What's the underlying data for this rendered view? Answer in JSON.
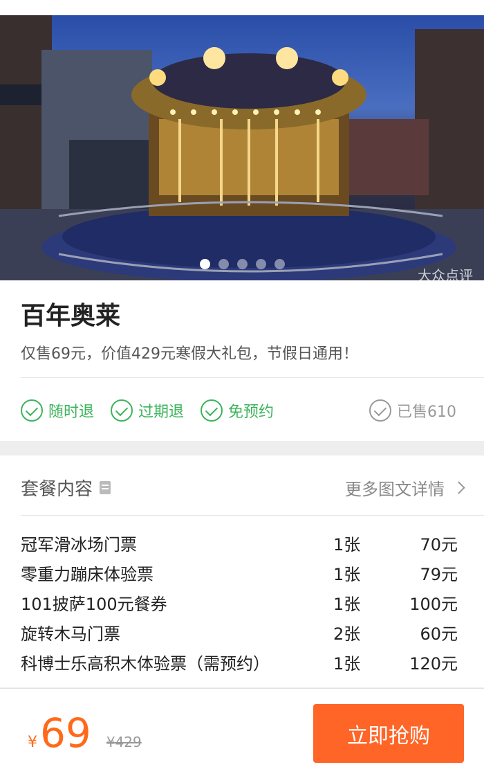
{
  "hero": {
    "image_desc": "carousel",
    "watermark": "大众点评",
    "carousel_dots": 5,
    "active_dot": 1
  },
  "deal": {
    "title": "百年奥莱",
    "subtitle": "仅售69元，价值429元寒假大礼包，节假日通用！",
    "badges": [
      "随时退",
      "过期退",
      "免预约"
    ],
    "sold": "已售610"
  },
  "package": {
    "title": "套餐内容",
    "more_link": "更多图文详情",
    "items": [
      {
        "name": "冠军滑冰场门票",
        "qty": "1张",
        "price": "70元"
      },
      {
        "name": "零重力蹦床体验票",
        "qty": "1张",
        "price": "79元"
      },
      {
        "name": "101披萨100元餐券",
        "qty": "1张",
        "price": "100元"
      },
      {
        "name": "旋转木马门票",
        "qty": "2张",
        "price": "60元"
      },
      {
        "name": "科博士乐高积木体验票（需预约）",
        "qty": "1张",
        "price": "120元"
      }
    ]
  },
  "bottom": {
    "currency": "¥",
    "price": "69",
    "original_price": "¥429",
    "buy_label": "立即抢购"
  },
  "colors": {
    "accent": "#ff6527",
    "price": "#ff6a1a",
    "badge_green": "#3bb35a"
  }
}
